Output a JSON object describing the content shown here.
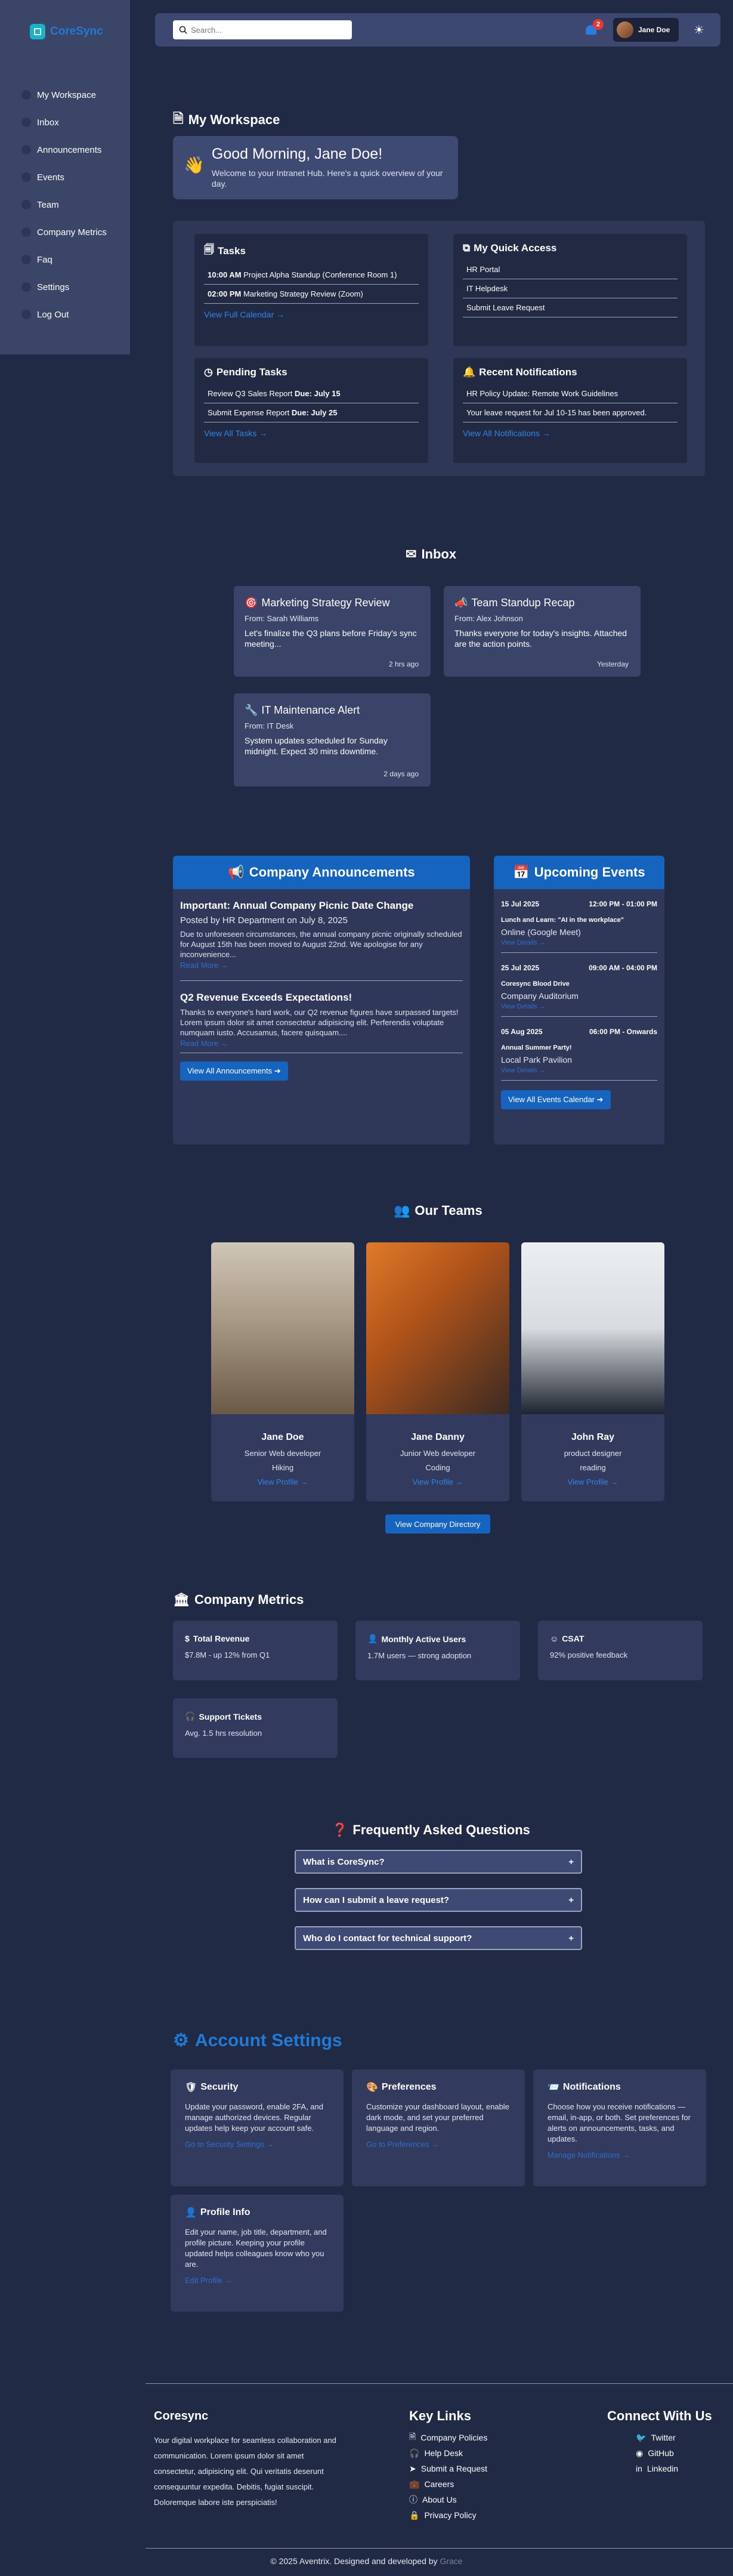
{
  "brand": {
    "name": "CoreSync"
  },
  "sidebar": {
    "items": [
      {
        "label": "My Workspace"
      },
      {
        "label": "Inbox"
      },
      {
        "label": "Announcements"
      },
      {
        "label": "Events"
      },
      {
        "label": "Team"
      },
      {
        "label": "Company Metrics"
      },
      {
        "label": "Faq"
      },
      {
        "label": "Settings"
      },
      {
        "label": "Log Out"
      }
    ]
  },
  "topbar": {
    "search_placeholder": "Search...",
    "notification_count": "2",
    "user_name": "Jane Doe"
  },
  "workspace": {
    "title": "My Workspace",
    "greeting": "Good Morning, Jane Doe!",
    "welcome": "Welcome to your Intranet Hub. Here's a quick overview of your day.",
    "tasks": {
      "title": "Tasks",
      "rows": [
        {
          "time": "10:00 AM",
          "text": "Project Alpha Standup (Conference Room 1)"
        },
        {
          "time": "02:00 PM",
          "text": "Marketing Strategy Review (Zoom)"
        }
      ],
      "link": "View Full Calendar →"
    },
    "quick_access": {
      "title": "My Quick Access",
      "rows": [
        "HR Portal",
        "IT Helpdesk",
        "Submit Leave Request"
      ]
    },
    "pending": {
      "title": "Pending Tasks",
      "rows": [
        {
          "text": "Review Q3 Sales Report",
          "due": "Due: July 15"
        },
        {
          "text": "Submit Expense Report",
          "due": "Due: July 25"
        }
      ],
      "link": "View All Tasks →"
    },
    "notifications": {
      "title": "Recent Notifications",
      "rows": [
        "HR Policy Update: Remote Work Guidelines",
        "Your leave request for Jul 10-15 has been approved."
      ],
      "link": "View All Notifications →"
    }
  },
  "inbox": {
    "title": "Inbox",
    "messages": [
      {
        "subject": "Marketing Strategy Review",
        "from": "From: Sarah Williams",
        "body": "Let's finalize the Q3 plans before Friday's sync meeting...",
        "time": "2 hrs ago"
      },
      {
        "subject": "Team Standup Recap",
        "from": "From: Alex Johnson",
        "body": "Thanks everyone for today's insights. Attached are the action points.",
        "time": "Yesterday"
      },
      {
        "subject": "IT Maintenance Alert",
        "from": "From: IT Desk",
        "body": "System updates scheduled for Sunday midnight. Expect 30 mins downtime.",
        "time": "2 days ago"
      }
    ]
  },
  "announcements": {
    "title": "Company Announcements",
    "items": [
      {
        "title": "Important: Annual Company Picnic Date Change",
        "meta": "Posted by HR Department on July 8, 2025",
        "body": "Due to unforeseen circumstances, the annual company picnic originally scheduled for August 15th has been moved to August 22nd. We apologise for any inconvenience...",
        "more": "Read More →"
      },
      {
        "title": "Q2 Revenue Exceeds Expectations!",
        "meta": "",
        "body": "Thanks to everyone's hard work, our Q2 revenue figures have surpassed targets! Lorem ipsum dolor sit amet consectetur adipisicing elit. Perferendis voluptate numquam iusto. Accusamus, facere quisquam....",
        "more": "Read More →"
      }
    ],
    "button": "View All Announcements ➔"
  },
  "events": {
    "title": "Upcoming Events",
    "items": [
      {
        "date": "15 Jul 2025",
        "time": "12:00 PM - 01:00 PM",
        "name": "Lunch and Learn: \"AI in the workplace\"",
        "place": "Online (Google Meet)",
        "link": "View Details →"
      },
      {
        "date": "25 Jul 2025",
        "time": "09:00 AM - 04:00 PM",
        "name": "Coresync Blood Drive",
        "place": "Company Auditorium",
        "link": "View Details →"
      },
      {
        "date": "05 Aug 2025",
        "time": "06:00 PM - Onwards",
        "name": "Annual Summer Party!",
        "place": "Local Park Pavilion",
        "link": "View Details →"
      }
    ],
    "button": "View All Events Calendar ➔"
  },
  "teams": {
    "title": "Our Teams",
    "members": [
      {
        "name": "Jane Doe",
        "role": "Senior Web developer",
        "hobby": "Hiking",
        "link": "View Profile →"
      },
      {
        "name": "Jane Danny",
        "role": "Junior Web developer",
        "hobby": "Coding",
        "link": "View Profile →"
      },
      {
        "name": "John Ray",
        "role": "product designer",
        "hobby": "reading",
        "link": "View Profile →"
      }
    ],
    "button": "View Company Directory"
  },
  "metrics": {
    "title": "Company Metrics",
    "items": [
      {
        "title": "Total Revenue",
        "value": "$7.8M - up 12% from Q1"
      },
      {
        "title": "Monthly Active Users",
        "value": "1.7M users — strong adoption"
      },
      {
        "title": "CSAT",
        "value": "92% positive feedback"
      },
      {
        "title": "Support Tickets",
        "value": "Avg. 1.5 hrs resolution"
      }
    ]
  },
  "faq": {
    "title": "Frequently Asked Questions",
    "items": [
      {
        "q": "What is CoreSync?"
      },
      {
        "q": "How can I submit a leave request?"
      },
      {
        "q": "Who do I contact for technical support?"
      }
    ]
  },
  "account": {
    "title": "Account Settings",
    "cards": [
      {
        "title": "Security",
        "body": "Update your password, enable 2FA, and manage authorized devices. Regular updates help keep your account safe.",
        "link": "Go to Security Settings →"
      },
      {
        "title": "Preferences",
        "body": "Customize your dashboard layout, enable dark mode, and set your preferred language and region.",
        "link": "Go to Preferences →"
      },
      {
        "title": "Notifications",
        "body": "Choose how you receive notifications — email, in-app, or both. Set preferences for alerts on announcements, tasks, and updates.",
        "link": "Manage Notifications →"
      },
      {
        "title": "Profile Info",
        "body": "Edit your name, job title, department, and profile picture. Keeping your profile updated helps colleagues know who you are.",
        "link": "Edit Profile →"
      }
    ]
  },
  "footer": {
    "brand": "Coresync",
    "about": "Your digital workplace for seamless collaboration and communication. Lorem ipsum dolor sit amet consectetur, adipisicing elit. Qui veritatis deserunt consequuntur expedita. Debitis, fugiat suscipit. Doloremque labore iste perspiciatis!",
    "links_title": "Key Links",
    "links": [
      "Company Policies",
      "Help Desk",
      "Submit a Request",
      "Careers",
      "About Us",
      "Privacy Policy"
    ],
    "social_title": "Connect With Us",
    "social": [
      "Twitter",
      "GitHub",
      "Linkedin"
    ],
    "copyright": "© 2025 Aventrix. Designed and developed by",
    "designer": "Grace"
  },
  "colors": {
    "accent": "#1565c0",
    "link": "#2b86e8",
    "bg": "#212a45",
    "card": "#323b5e"
  }
}
